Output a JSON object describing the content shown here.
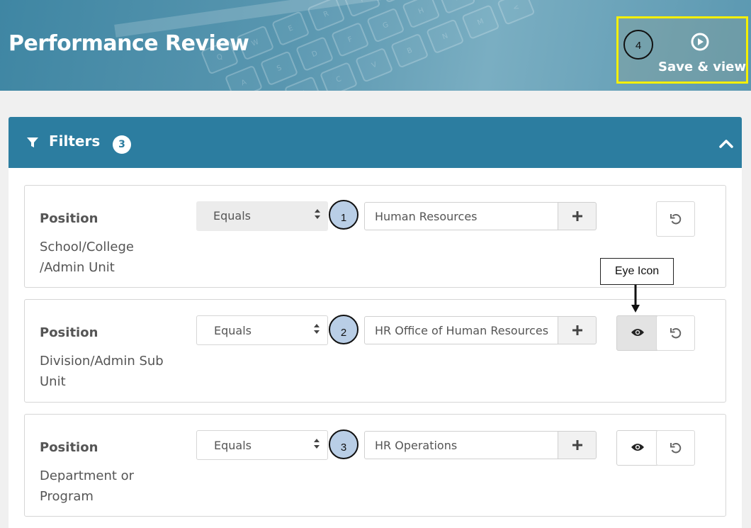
{
  "header": {
    "title": "Performance Review",
    "save_view_label": "Save & view",
    "save_view_callout": "4",
    "keyboard_keys": [
      "Q",
      "W",
      "E",
      "R",
      "T",
      "Y",
      "U",
      "I",
      "A",
      "S",
      "D",
      "F",
      "G",
      "H",
      "J",
      "K",
      "Z",
      "X",
      "C",
      "V",
      "B",
      "N",
      "M",
      "<"
    ]
  },
  "filters": {
    "title": "Filters",
    "count": "3",
    "rows": [
      {
        "field": "Position",
        "subfield": "School/College /Admin Unit",
        "operator": "Equals",
        "value": "Human Resources",
        "callout": "1",
        "has_eye": false
      },
      {
        "field": "Position",
        "subfield": "Division/Admin Sub Unit",
        "operator": "Equals",
        "value": "HR Office of Human Resources",
        "callout": "2",
        "has_eye": true,
        "eye_active": true
      },
      {
        "field": "Position",
        "subfield": "Department or Program",
        "operator": "Equals",
        "value": "HR Operations",
        "callout": "3",
        "has_eye": true,
        "eye_active": false
      }
    ]
  },
  "annotation": {
    "eye_icon_label": "Eye Icon"
  },
  "colors": {
    "header_bg": "#4a8dab",
    "panel_header_bg": "#2c7da0",
    "highlight_border": "#f5f000",
    "callout_fill": "#b9cee6"
  }
}
